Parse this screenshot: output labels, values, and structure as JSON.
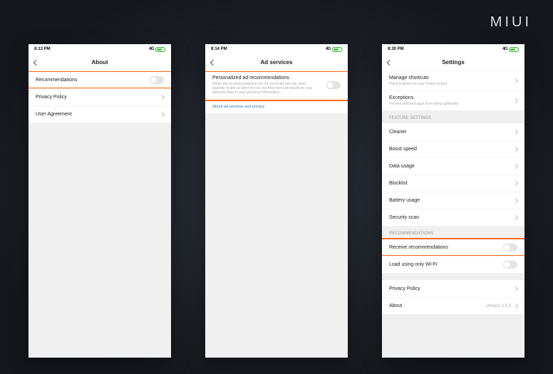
{
  "brand": "MIUI",
  "status": {
    "signal": "4G",
    "times": [
      "8:13 PM",
      "8:14 PM",
      "8:30 PM"
    ]
  },
  "screen1": {
    "title": "About",
    "rows": {
      "recommendations": "Recommendations",
      "privacy": "Privacy Policy",
      "agreement": "User Agreement"
    }
  },
  "screen2": {
    "title": "Ad services",
    "row": {
      "title": "Personalized ad recommendations",
      "sub": "When the recommendations are off, you'll still see the same quantity of ads as when it's on, but they won't be based on your behavior data or your personal information."
    },
    "link": "About ad services and privacy"
  },
  "screen3": {
    "title": "Settings",
    "shortcuts": {
      "title": "Manage shortcuts",
      "sub": "Place features on your Home screen"
    },
    "exceptions": {
      "title": "Exceptions",
      "sub": "Prevent selected apps from being optimized"
    },
    "section_feature": "FEATURE SETTINGS",
    "feature_rows": [
      "Cleaner",
      "Boost speed",
      "Data usage",
      "Blocklist",
      "Battery usage",
      "Security scan"
    ],
    "section_rec": "RECOMMENDATIONS",
    "receive": "Receive recommendations",
    "wifi": "Load using only Wi-Fi",
    "privacy": "Privacy Policy",
    "about": {
      "label": "About",
      "value": "Version 2.6.3"
    }
  }
}
